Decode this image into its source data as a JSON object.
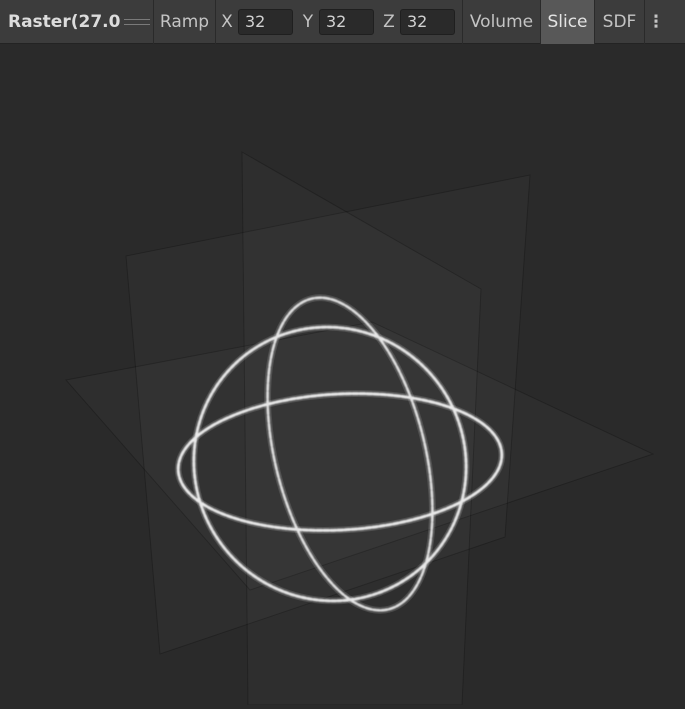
{
  "toolbar": {
    "title": "Raster(27.0",
    "ramp_label": "Ramp",
    "axes": [
      {
        "label": "X",
        "value": "32"
      },
      {
        "label": "Y",
        "value": "32"
      },
      {
        "label": "Z",
        "value": "32"
      }
    ],
    "volume_label": "Volume",
    "slice_label": "Slice",
    "sdf_label": "SDF",
    "more_icon": "vertical-ellipsis-icon",
    "active_mode": "Slice"
  },
  "viewport": {
    "content": "3d-slice-preview",
    "background_color": "#2a2a2a",
    "ring_color": "#e6e6e6"
  }
}
